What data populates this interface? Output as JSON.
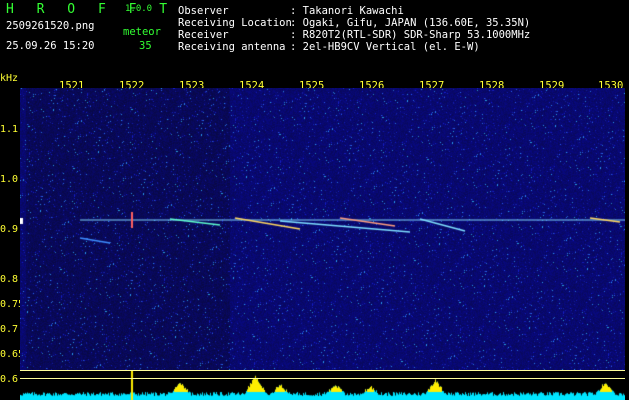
{
  "app": {
    "logo": "H R O F F T",
    "version": "1.0.0",
    "filename": "2509261520.png",
    "timestamp": "25.09.26 15:20",
    "count_label": "meteor",
    "count_value": "35"
  },
  "info": {
    "rows": [
      {
        "label": "Observer",
        "value": ": Takanori Kawachi"
      },
      {
        "label": "Receiving Location",
        "value": ": Ogaki, Gifu, JAPAN (136.60E, 35.35N)"
      },
      {
        "label": "Receiver",
        "value": ": R820T2(RTL-SDR) SDR-Sharp 53.1000MHz"
      },
      {
        "label": "Receiving antenna",
        "value": ": 2el-HB9CV Vertical (el. E-W)"
      }
    ]
  },
  "axis": {
    "x_ticks": [
      "1521",
      "1522",
      "1523",
      "1524",
      "1525",
      "1526",
      "1527",
      "1528",
      "1529",
      "1530"
    ],
    "y_unit": "kHz",
    "y_ticks": [
      "1.1",
      "1.0",
      "0.9",
      "0.8",
      "0.75",
      "0.7",
      "0.65",
      "0.6"
    ]
  },
  "colors": {
    "background": "#000000",
    "header_green": "#33ff33",
    "header_white": "#ffffff",
    "axis_yellow": "#ffff33",
    "spectrogram_bg": "#0a0a6e",
    "power_bar": "#00e5ff",
    "power_peak": "#ffee00"
  }
}
